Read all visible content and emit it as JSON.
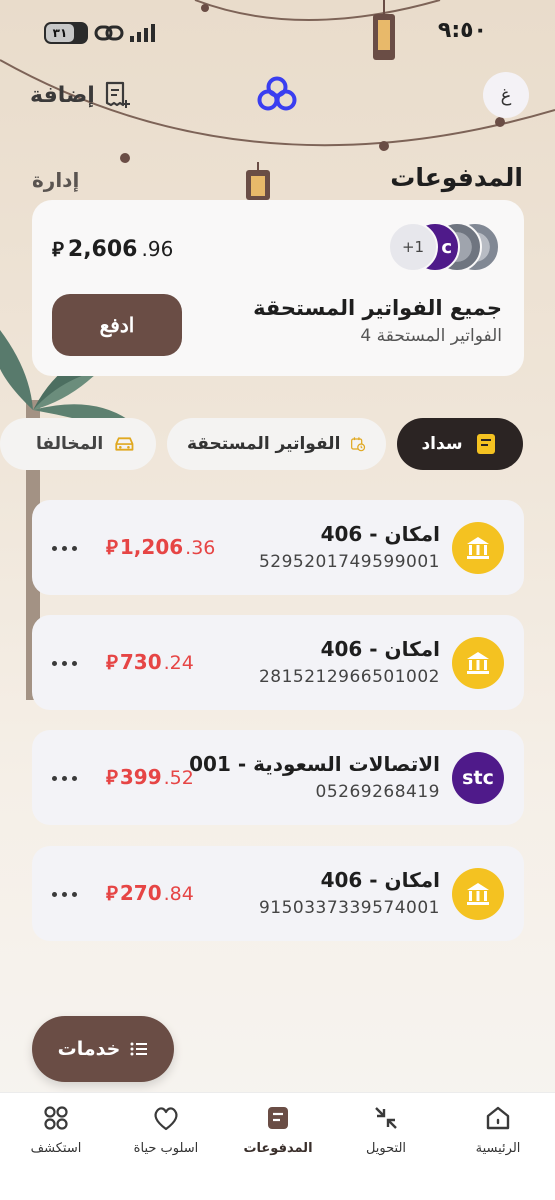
{
  "status_bar": {
    "time": "٩:٥٠",
    "battery": "٣١"
  },
  "header": {
    "add_label": "إضافة",
    "avatar_letter": "غ",
    "section_title": "المدفوعات",
    "manage_label": "إدارة"
  },
  "summary": {
    "amount_int": "2,606",
    "amount_dec": ".96",
    "currency": "⃁",
    "extra_count": "+1",
    "stc_letter": "c",
    "pay_label": "ادفع",
    "title": "جميع الفواتير المستحقة",
    "subtitle": "4 الفواتير المستحقة"
  },
  "tabs": [
    {
      "label": "سداد",
      "icon": "receipt-icon",
      "active": true
    },
    {
      "label": "الفواتير المستحقة",
      "icon": "calendar-clock-icon",
      "active": false
    },
    {
      "label": "المخالفا",
      "icon": "car-icon",
      "active": false
    }
  ],
  "bills": [
    {
      "name": "406 - امكان",
      "account": "5295201749599001",
      "amount_int": "1,206",
      "amount_dec": ".36",
      "logo": "bank-icon"
    },
    {
      "name": "406 - امكان",
      "account": "2815212966501002",
      "amount_int": "730",
      "amount_dec": ".24",
      "logo": "bank-icon"
    },
    {
      "name": "001 - الاتصالات السعودية",
      "account": "05269268419",
      "amount_int": "399",
      "amount_dec": ".52",
      "logo": "stc-logo",
      "logo_text": "stc"
    },
    {
      "name": "406 - امكان",
      "account": "9150337339574001",
      "amount_int": "270",
      "amount_dec": ".84",
      "logo": "bank-icon"
    }
  ],
  "services_label": "خدمات",
  "nav": [
    {
      "label": "الرئيسية",
      "icon": "home-icon"
    },
    {
      "label": "التحويل",
      "icon": "transfer-arrows-icon"
    },
    {
      "label": "المدفوعات",
      "icon": "payments-icon",
      "active": true
    },
    {
      "label": "اسلوب حياة",
      "icon": "heart-icon"
    },
    {
      "label": "استكشف",
      "icon": "grid-icon"
    }
  ],
  "colors": {
    "primary_brown": "#6a4d45",
    "dark": "#2b2423",
    "amount_red": "#e64545",
    "bank_gold": "#f4c221",
    "stc_purple": "#4f1a8a",
    "logo_blue": "#3a3ef0"
  }
}
